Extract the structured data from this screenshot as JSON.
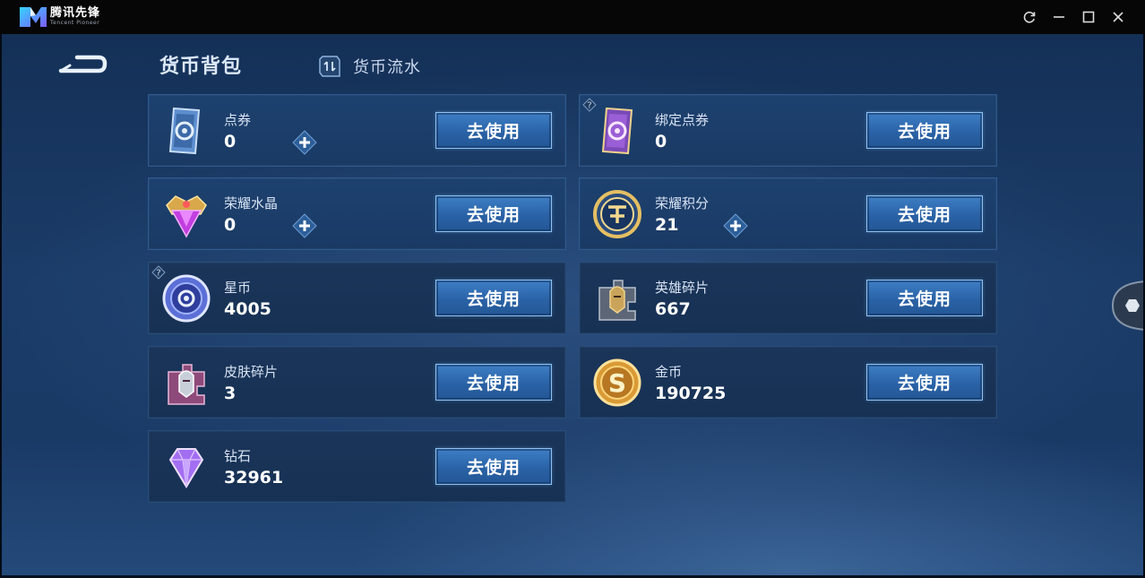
{
  "titlebar": {
    "app_name": "腾讯先锋",
    "app_sub": "Tencent Pioneer",
    "buttons": [
      "refresh-icon",
      "minimize-icon",
      "maximize-icon",
      "close-icon"
    ]
  },
  "header": {
    "back_icon": "back-arrow-icon",
    "tab_bag": "货币背包",
    "tab_flow": "货币流水",
    "tab_flow_icon": "exchange-card-icon"
  },
  "use_label": "去使用",
  "cards": [
    {
      "name": "点券",
      "value": "0",
      "icon": "voucher-icon",
      "plus": true,
      "help": false
    },
    {
      "name": "绑定点券",
      "value": "0",
      "icon": "bound-voucher-icon",
      "plus": false,
      "help": true
    },
    {
      "name": "荣耀水晶",
      "value": "0",
      "icon": "glory-crystal-icon",
      "plus": true,
      "help": false
    },
    {
      "name": "荣耀积分",
      "value": "21",
      "icon": "glory-points-icon",
      "plus": true,
      "help": false
    },
    {
      "name": "星币",
      "value": "4005",
      "icon": "star-coin-icon",
      "plus": false,
      "help": true
    },
    {
      "name": "英雄碎片",
      "value": "667",
      "icon": "hero-fragment-icon",
      "plus": false,
      "help": false
    },
    {
      "name": "皮肤碎片",
      "value": "3",
      "icon": "skin-fragment-icon",
      "plus": false,
      "help": false
    },
    {
      "name": "金币",
      "value": "190725",
      "icon": "gold-coin-icon",
      "plus": false,
      "help": false
    },
    {
      "name": "钻石",
      "value": "32961",
      "icon": "diamond-icon",
      "plus": false,
      "help": false
    }
  ],
  "colors": {
    "titlebar": "#060606",
    "background": "#1b3c68",
    "card": "#1d416f",
    "button": "#2f6cb3",
    "button_border": "#8fc2ef"
  }
}
